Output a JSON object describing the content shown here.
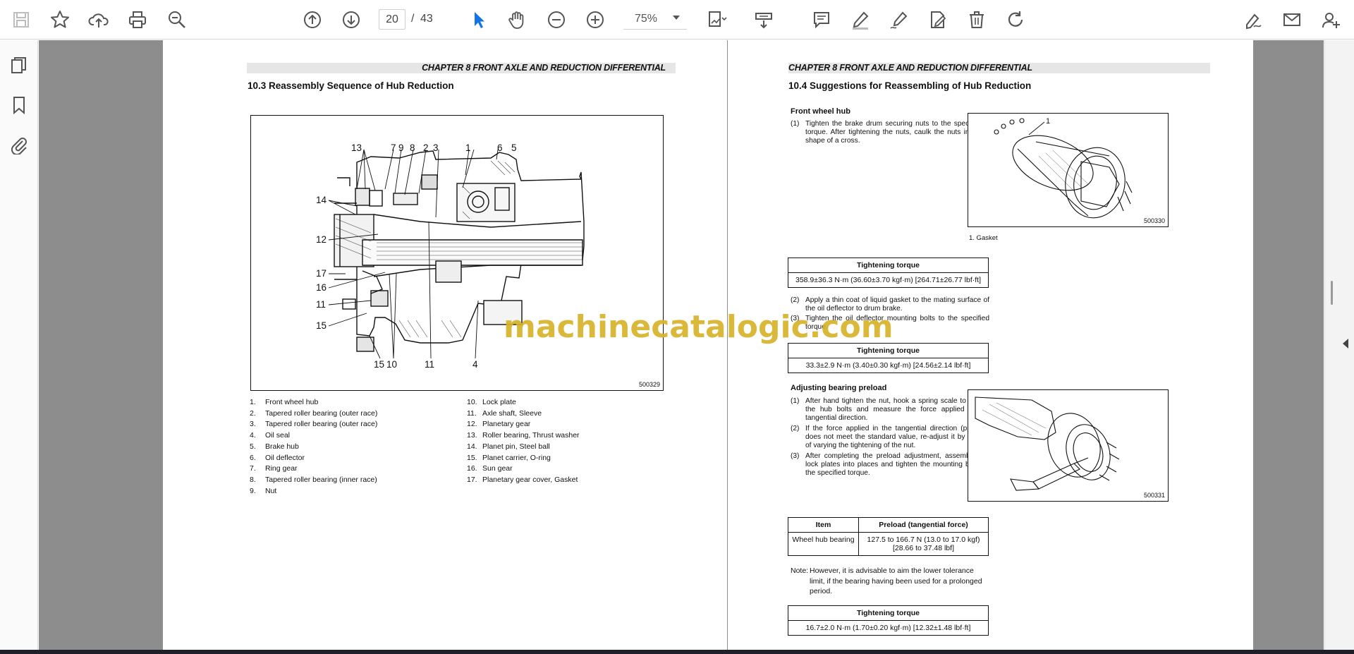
{
  "toolbar": {
    "current_page": "20",
    "page_separator": "/",
    "total_pages": "43",
    "zoom": "75%"
  },
  "watermark": "machinecatalogic.com",
  "left_page": {
    "chapter": "CHAPTER 8  FRONT AXLE AND REDUCTION DIFFERENTIAL",
    "section": "10.3    Reassembly Sequence of Hub Reduction",
    "figure_code": "500329",
    "callouts": {
      "c13": "13",
      "c7": "7",
      "c9": "9",
      "c8": "8",
      "c2": "2",
      "c3": "3",
      "c1": "1",
      "c6": "6",
      "c5": "5",
      "c14": "14",
      "c12": "12",
      "c17": "17",
      "c16": "16",
      "c11a": "11",
      "c15a": "15",
      "c15b": "15",
      "c10": "10",
      "c11b": "11",
      "c4": "4"
    },
    "legend_left": [
      {
        "n": "1.",
        "t": "Front wheel hub"
      },
      {
        "n": "2.",
        "t": "Tapered roller bearing (outer race)"
      },
      {
        "n": "3.",
        "t": "Tapered roller bearing (outer race)"
      },
      {
        "n": "4.",
        "t": "Oil seal"
      },
      {
        "n": "5.",
        "t": "Brake hub"
      },
      {
        "n": "6.",
        "t": "Oil deflector"
      },
      {
        "n": "7.",
        "t": "Ring gear"
      },
      {
        "n": "8.",
        "t": "Tapered roller bearing (inner race)"
      },
      {
        "n": "9.",
        "t": "Nut"
      }
    ],
    "legend_right": [
      {
        "n": "10.",
        "t": "Lock plate"
      },
      {
        "n": "11.",
        "t": "Axle shaft, Sleeve"
      },
      {
        "n": "12.",
        "t": "Planetary gear"
      },
      {
        "n": "13.",
        "t": "Roller bearing, Thrust washer"
      },
      {
        "n": "14.",
        "t": "Planet pin, Steel ball"
      },
      {
        "n": "15.",
        "t": "Planet carrier, O-ring"
      },
      {
        "n": "16.",
        "t": "Sun gear"
      },
      {
        "n": "17.",
        "t": "Planetary gear cover, Gasket"
      }
    ]
  },
  "right_page": {
    "chapter": "CHAPTER 8  FRONT AXLE AND REDUCTION DIFFERENTIAL",
    "section": "10.4    Suggestions for Reassembling of Hub Reduction",
    "front_wheel_hub": "Front wheel hub",
    "p1_n": "(1)",
    "p1": "Tighten the brake drum securing nuts to the specified torque. After tightening the nuts, caulk the nuts in the shape of a cross.",
    "fig1_code": "500330",
    "fig1_callout": "1",
    "fig1_caption": "1. Gasket",
    "torque_label": "Tightening torque",
    "torque1": "358.9±36.3 N·m (36.60±3.70 kgf·m) [264.71±26.77 lbf·ft]",
    "p2_n": "(2)",
    "p2": "Apply a thin coat of liquid gasket to the mating surface of the oil deflector to drum brake.",
    "p3_n": "(3)",
    "p3": "Tighten the oil deflector mounting bolts to the specified torque.",
    "torque2": "33.3±2.9 N·m (3.40±0.30 kgf·m) [24.56±2.14 lbf·ft]",
    "adjusting": "Adjusting bearing preload",
    "a1_n": "(1)",
    "a1": "After hand tighten the nut, hook a spring scale to one of the hub bolts and measure the force applied in the tangential direction.",
    "a2_n": "(2)",
    "a2": "If the force applied in the tangential direction (preload) does not meet the standard value, re-adjust it by means of varying the tightening of the nut.",
    "a3_n": "(3)",
    "a3": "After completing the preload adjustment, assemble the lock plates into places and tighten the mounting bolts to the specified torque.",
    "fig2_code": "500331",
    "preload_table": {
      "h_item": "Item",
      "h_value": "Preload (tangential force)",
      "item": "Wheel hub bearing",
      "value_line1": "127.5 to 166.7 N (13.0 to 17.0 kgf)",
      "value_line2": "[28.66 to 37.48 lbf]"
    },
    "note_label": "Note:",
    "note": "However, it is advisable to aim the lower tolerance limit, if the bearing having been used for a prolonged period.",
    "torque3": "16.7±2.0 N·m (1.70±0.20 kgf·m) [12.32±1.48 lbf·ft]"
  },
  "icons": {
    "toolbar": [
      "save-icon",
      "star-icon",
      "cloud-upload-icon",
      "print-icon",
      "zoom-search-icon",
      "page-up-icon",
      "page-down-icon",
      "select-pointer-icon",
      "hand-pan-icon",
      "zoom-out-icon",
      "zoom-in-icon",
      "page-fit-icon",
      "scroll-mode-icon",
      "comment-icon",
      "highlight-pen-icon",
      "draw-sign-icon",
      "edit-pdf-icon",
      "delete-icon",
      "rotate-icon",
      "fill-sign-icon",
      "email-icon",
      "share-user-icon"
    ],
    "sidebar": [
      "page-thumbnails-icon",
      "bookmark-icon",
      "attachment-icon"
    ]
  },
  "colors": {
    "accent": "#1473e6",
    "viewer_bg": "#8d8d8d",
    "watermark": "#d6b22a"
  }
}
